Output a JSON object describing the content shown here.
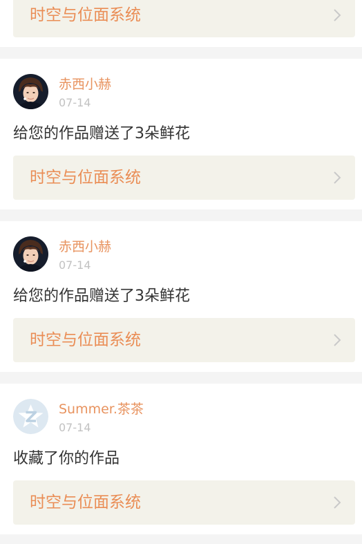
{
  "feed": {
    "items": [
      {
        "work_title": "时空与位面系统"
      },
      {
        "username": "赤西小赫",
        "date": "07-14",
        "action": "给您的作品赠送了3朵鲜花",
        "work_title": "时空与位面系统",
        "avatar_icon": "user-photo-avatar"
      },
      {
        "username": "赤西小赫",
        "date": "07-14",
        "action": "给您的作品赠送了3朵鲜花",
        "work_title": "时空与位面系统",
        "avatar_icon": "user-photo-avatar"
      },
      {
        "username": "Summer.茶茶",
        "date": "07-14",
        "action": "收藏了你的作品",
        "work_title": "时空与位面系统",
        "avatar_icon": "default-z-avatar"
      }
    ]
  },
  "colors": {
    "accent": "#e8935f",
    "link_background": "#f3f2ea",
    "page_background": "#f4f4f4",
    "card_background": "#ffffff",
    "body_text": "#333333",
    "muted_text": "#c2c2c2"
  }
}
